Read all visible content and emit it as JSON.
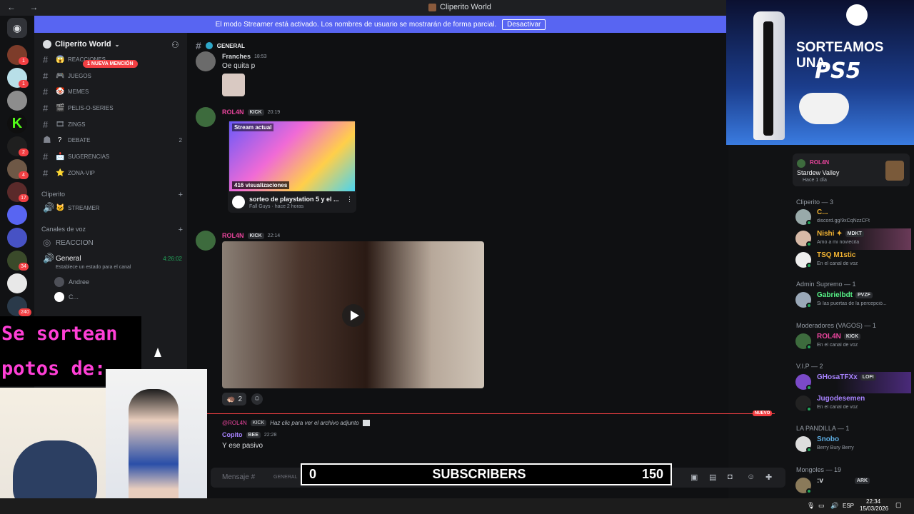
{
  "titlebar": {
    "title": "Cliperito World",
    "nav": "← →"
  },
  "banner": {
    "text": "El modo Streamer está activado. Los nombres de usuario se mostrarán de forma parcial.",
    "button": "Desactivar"
  },
  "guild_badges": [
    "1",
    "1",
    "2",
    "4",
    "17",
    "34",
    "240"
  ],
  "server": {
    "name": "Cliperito World"
  },
  "mention_pill": "1 NUEVA MENCIÓN",
  "channels": [
    {
      "name": "REACCIONES",
      "emoji": "😱",
      "count": ""
    },
    {
      "name": "JUEGOS",
      "emoji": "🎮",
      "count": ""
    },
    {
      "name": "MEMES",
      "emoji": "🤡",
      "count": ""
    },
    {
      "name": "PELIS-O-SERIES",
      "emoji": "🎬",
      "count": ""
    },
    {
      "name": "ZINGS",
      "emoji": "🎞",
      "count": ""
    },
    {
      "name": "DEBATE",
      "emoji": "?",
      "count": "2"
    },
    {
      "name": "SUGERENCIAS",
      "emoji": "📩",
      "count": ""
    },
    {
      "name": "ZONA-VIP",
      "emoji": "⭐",
      "count": ""
    }
  ],
  "category_cliperito": "Cliperito",
  "streamer_channel": "STREAMER",
  "category_voz": "Canales de voz",
  "voice": {
    "reaccion": "REACCION",
    "general": "General",
    "general_timer": "4:26:02",
    "status_hint": "Establece un estado para el canal",
    "users": [
      "Andree",
      "C..."
    ]
  },
  "chat": {
    "channel": "GENERAL",
    "messages": [
      {
        "user": "Franches",
        "time": "18:53",
        "text": "Oe quita p"
      },
      {
        "user": "ROL4N",
        "tag": "KICK",
        "time": "20:19",
        "embed": {
          "label": "Stream actual",
          "views": "416 visualizaciones",
          "title": "sorteo de playstation 5 y el ...",
          "sub": "Fall Guys · hace 2 horas"
        }
      },
      {
        "user": "ROL4N",
        "tag": "KICK",
        "time": "22:14",
        "reaction_count": "2"
      },
      {
        "reply_user": "@ROL4N",
        "reply_tag": "KICK",
        "reply_text": "Haz clic para ver el archivo adjunto",
        "user": "Copito",
        "tag": "BEE",
        "time": "22:28",
        "text": "Y ese pasivo"
      }
    ],
    "new_divider": "NUEVO",
    "input_placeholder": "Mensaje #",
    "input_channel": "GENERAL"
  },
  "members": {
    "now_playing": {
      "user": "ROL4N",
      "game": "Stardew Valley",
      "since": "Hace 1 día"
    },
    "groups": [
      {
        "title": "Cliperito — 3",
        "items": [
          {
            "name": "C...",
            "status": "discord.gg/9xCqNzzCFt",
            "color": "#f0b232",
            "tag": ""
          },
          {
            "name": "Nishi ✦",
            "status": "Amo a mi noviecita",
            "color": "#f0b232",
            "tag": "MDKT"
          },
          {
            "name": "TSQ M1stic",
            "status": "En el canal de voz",
            "color": "#f0b232",
            "tag": ""
          }
        ]
      },
      {
        "title": "Admin Supremo — 1",
        "items": [
          {
            "name": "Gabrielbdt",
            "status": "Si las puertas de la percepció...",
            "color": "#57f287",
            "tag": "PVZF"
          }
        ]
      },
      {
        "title": "Moderadores (VAGOS) — 1",
        "items": [
          {
            "name": "ROL4N",
            "status": "En el canal de voz",
            "color": "#eb459e",
            "tag": "KICK"
          }
        ]
      },
      {
        "title": "V.I.P — 2",
        "items": [
          {
            "name": "GHosaTFXx",
            "status": "",
            "color": "#a883ff",
            "tag": "LOFI"
          },
          {
            "name": "Jugodesemen",
            "status": "En el canal de voz",
            "color": "#a883ff",
            "tag": ""
          }
        ]
      },
      {
        "title": "LA PANDILLA — 1",
        "items": [
          {
            "name": "Snobo",
            "status": "Berry Bury Berry",
            "color": "#5dade2",
            "tag": ""
          }
        ]
      },
      {
        "title": "Mongoles — 19",
        "items": [
          {
            "name": ":v",
            "status": "",
            "color": "#dbdee1",
            "tag": "ARK"
          }
        ]
      }
    ]
  },
  "overlay": {
    "ps5_line1": "SORTEAMOS UNA",
    "ps5_line2": "PS5",
    "ps5_badge": "",
    "sortean_line1": "Se sortean",
    "sortean_line2": "potos de:",
    "subscribers_left": "0",
    "subscribers_label": "SUBSCRIBERS",
    "subscribers_right": "150"
  },
  "taskbar": {
    "lang": "ESP",
    "time": "22:34",
    "date": "15/03/2026"
  }
}
